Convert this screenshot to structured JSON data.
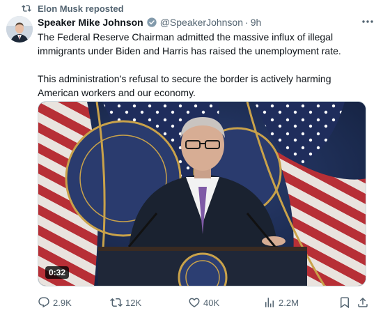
{
  "repost": {
    "icon": "repost-icon",
    "text": "Elon Musk reposted"
  },
  "author": {
    "name": "Speaker Mike Johnson",
    "verified_icon": "verified-badge-icon",
    "handle": "@SpeakerJohnson",
    "separator": "·",
    "time": "9h"
  },
  "tweet": {
    "paragraphs": [
      "The Federal Reserve Chairman admitted the massive influx of illegal immigrants under Biden and Harris has raised the unemployment rate.",
      "This administration’s refusal to secure the border is actively harming American workers and our economy."
    ]
  },
  "media": {
    "type": "video",
    "duration": "0:32"
  },
  "actions": {
    "replies": "2.9K",
    "reposts": "12K",
    "likes": "40K",
    "views": "2.2M"
  },
  "colors": {
    "text": "#0f1419",
    "secondary": "#536471",
    "verified": "#829aab",
    "border": "#cfd9de"
  }
}
